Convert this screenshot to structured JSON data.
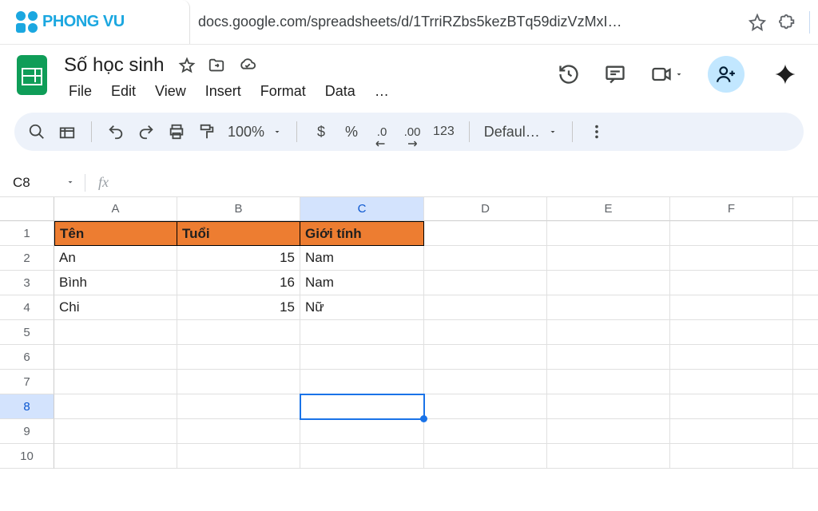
{
  "browser": {
    "logo_text": "PHONG VU",
    "url": "docs.google.com/spreadsheets/d/1TrriRZbs5kezBTq59dizVzMxI…"
  },
  "doc": {
    "title": "Số học sinh",
    "menus": {
      "file": "File",
      "edit": "Edit",
      "view": "View",
      "insert": "Insert",
      "format": "Format",
      "data": "Data",
      "more": "…"
    }
  },
  "toolbar": {
    "zoom": "100%",
    "currency": "$",
    "percent": "%",
    "dec_dec": ".0",
    "inc_dec": ".00",
    "num123": "123",
    "font": "Defaul…"
  },
  "formula_bar": {
    "cell_ref": "C8",
    "fx": "fx"
  },
  "sheet": {
    "columns": [
      "A",
      "B",
      "C",
      "D",
      "E",
      "F"
    ],
    "row_count": 10,
    "selected_col": "C",
    "selected_row": 8,
    "header_row": {
      "ten": "Tên",
      "tuoi": "Tuổi",
      "gioi_tinh": "Giới tính"
    },
    "data": [
      {
        "ten": "An",
        "tuoi": "15",
        "gioi_tinh": "Nam"
      },
      {
        "ten": "Bình",
        "tuoi": "16",
        "gioi_tinh": "Nam"
      },
      {
        "ten": "Chi",
        "tuoi": "15",
        "gioi_tinh": "Nữ"
      }
    ]
  }
}
